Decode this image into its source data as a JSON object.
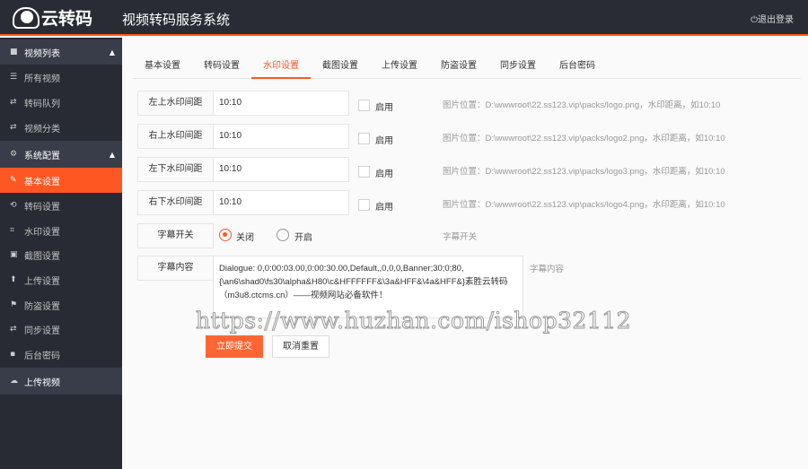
{
  "header": {
    "logo_text": "云转码",
    "title": "视频转码服务系统",
    "logout": "退出登录"
  },
  "sidebar": {
    "groups": [
      {
        "label": "视频列表",
        "items": [
          "所有视频",
          "转码队列",
          "视频分类"
        ]
      },
      {
        "label": "系统配置",
        "items": [
          "基本设置",
          "转码设置",
          "水印设置",
          "截图设置",
          "上传设置",
          "防盗设置",
          "同步设置",
          "后台密码"
        ]
      }
    ],
    "upload": "上传视频",
    "active": "基本设置"
  },
  "tabs": [
    "基本设置",
    "转码设置",
    "水印设置",
    "截图设置",
    "上传设置",
    "防盗设置",
    "同步设置",
    "后台密码"
  ],
  "active_tab": "水印设置",
  "form": {
    "rows": [
      {
        "label": "左上水印间距",
        "value": "10:10",
        "check": "启用",
        "checked": false,
        "hint": "图片位置：D:\\wwwroot\\22.ss123.vip\\packs/logo.png，水印距离，如10:10"
      },
      {
        "label": "右上水印间距",
        "value": "10:10",
        "check": "启用",
        "checked": false,
        "hint": "图片位置：D:\\wwwroot\\22.ss123.vip\\packs/logo2.png，水印距离，如10:10"
      },
      {
        "label": "左下水印间距",
        "value": "10:10",
        "check": "启用",
        "checked": false,
        "hint": "图片位置：D:\\wwwroot\\22.ss123.vip\\packs/logo3.png，水印距离，如10:10"
      },
      {
        "label": "右下水印间距",
        "value": "10:10",
        "check": "启用",
        "checked": false,
        "hint": "图片位置：D:\\wwwroot\\22.ss123.vip\\packs/logo4.png，水印距离，如10:10"
      }
    ],
    "subtitle_switch": {
      "label": "字幕开关",
      "off": "关闭",
      "on": "开启",
      "selected": "关闭",
      "hint": "字幕开关"
    },
    "subtitle_content": {
      "label": "字幕内容",
      "value": "Dialogue: 0,0:00:03.00,0:00:30.00,Default,,0,0,0,Banner;30;0;80,{\\an6\\shad0\\fs30\\alpha&H80\\c&HFFFFFF&\\3a&HFF&\\4a&HFF&}素胜云转码（m3u8.ctcms.cn）——视频网站必备软件！",
      "hint": "字幕内容"
    },
    "submit": "立即提交",
    "reset": "取消重置"
  },
  "watermark": "https://www.huzhan.com/ishop32112",
  "colors": {
    "accent": "#ff5722",
    "header_bg": "#2a2c35",
    "sidebar_bg": "#282b33"
  }
}
